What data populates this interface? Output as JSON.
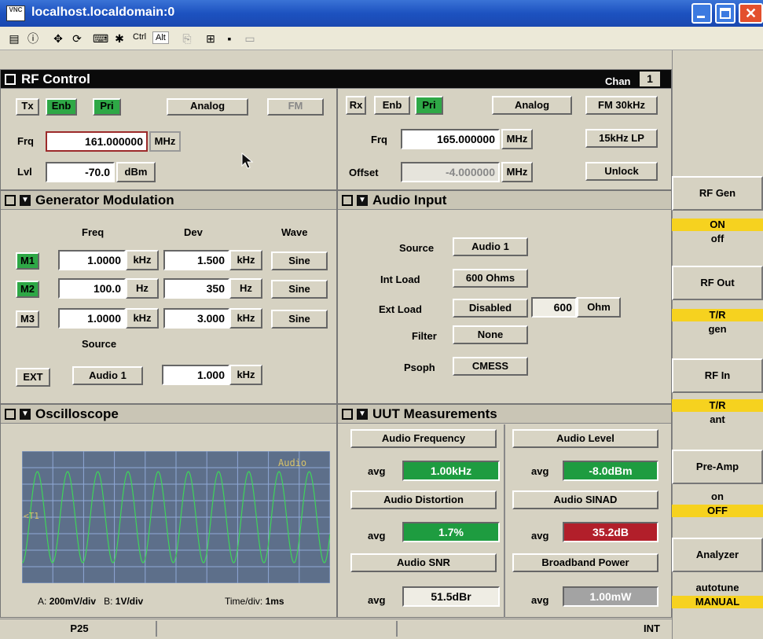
{
  "window": {
    "title": "localhost.localdomain:0",
    "vnc": "VNC"
  },
  "toolbar": {
    "ctrl": "Ctrl",
    "alt": "Alt"
  },
  "rf": {
    "title": "RF Control",
    "chan_label": "Chan",
    "chan": "1",
    "tx": {
      "tx": "Tx",
      "enb": "Enb",
      "pri": "Pri",
      "analog": "Analog",
      "fm": "FM",
      "frq_label": "Frq",
      "frq": "161.000000",
      "frq_unit": "MHz",
      "lvl_label": "Lvl",
      "lvl": "-70.0",
      "lvl_unit": "dBm"
    },
    "rx": {
      "rx": "Rx",
      "enb": "Enb",
      "pri": "Pri",
      "analog": "Analog",
      "fm": "FM 30kHz",
      "lp": "15kHz LP",
      "frq_label": "Frq",
      "frq": "165.000000",
      "frq_unit": "MHz",
      "offset_label": "Offset",
      "offset": "-4.000000",
      "offset_unit": "MHz",
      "unlock": "Unlock"
    }
  },
  "gen": {
    "title": "Generator Modulation",
    "col_freq": "Freq",
    "col_dev": "Dev",
    "col_wave": "Wave",
    "rows": [
      {
        "m": "M1",
        "freq": "1.0000",
        "funit": "kHz",
        "dev": "1.500",
        "dunit": "kHz",
        "wave": "Sine"
      },
      {
        "m": "M2",
        "freq": "100.0",
        "funit": "Hz",
        "dev": "350",
        "dunit": "Hz",
        "wave": "Sine"
      },
      {
        "m": "M3",
        "freq": "1.0000",
        "funit": "kHz",
        "dev": "3.000",
        "dunit": "kHz",
        "wave": "Sine"
      }
    ],
    "source_label": "Source",
    "ext": "EXT",
    "source": "Audio 1",
    "src_freq": "1.000",
    "src_unit": "kHz"
  },
  "audio": {
    "title": "Audio Input",
    "source_label": "Source",
    "source": "Audio 1",
    "int_label": "Int Load",
    "int_val": "600 Ohms",
    "ext_label": "Ext Load",
    "ext_val": "Disabled",
    "ext_num": "600",
    "ext_unit": "Ohm",
    "filter_label": "Filter",
    "filter": "None",
    "psoph_label": "Psoph",
    "psoph": "CMESS"
  },
  "scope": {
    "title": "Oscilloscope",
    "trace": "Audio",
    "marker": "<T1",
    "a_label": "A:",
    "a_val": "200mV/div",
    "b_label": "B:",
    "b_val": "1V/div",
    "t_label": "Time/div:",
    "t_val": "1ms"
  },
  "uut": {
    "title": "UUT Measurements",
    "avg": "avg",
    "items": [
      {
        "name": "Audio Frequency",
        "value": "1.00kHz",
        "color": "#1e9c40"
      },
      {
        "name": "Audio Level",
        "value": "-8.0dBm",
        "color": "#1e9c40"
      },
      {
        "name": "Audio Distortion",
        "value": "1.7%",
        "color": "#1e9c40"
      },
      {
        "name": "Audio SINAD",
        "value": "35.2dB",
        "color": "#b21f2a"
      },
      {
        "name": "Audio SNR",
        "value": "51.5dBr",
        "color": "#efede4"
      },
      {
        "name": "Broadband Power",
        "value": "1.00mW",
        "color": "#a3a3a3"
      }
    ]
  },
  "side": {
    "rfgen": "RF Gen",
    "rfgen_on": "ON",
    "rfgen_off": "off",
    "rfout": "RF Out",
    "rfout_a": "T/R",
    "rfout_b": "gen",
    "rfin": "RF In",
    "rfin_a": "T/R",
    "rfin_b": "ant",
    "preamp": "Pre-Amp",
    "preamp_on": "on",
    "preamp_off": "OFF",
    "analyzer": "Analyzer",
    "an_a": "autotune",
    "an_b": "MANUAL"
  },
  "status": {
    "left": "P25",
    "right": "INT"
  }
}
